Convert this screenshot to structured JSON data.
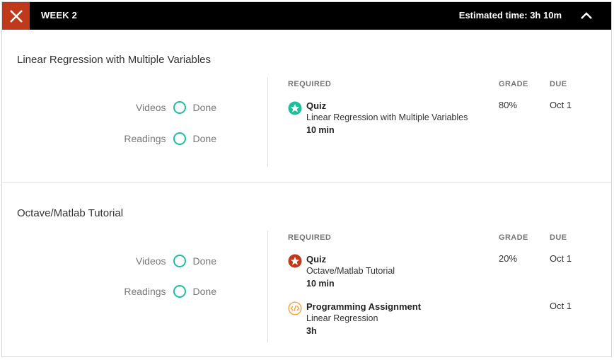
{
  "header": {
    "week_label": "WEEK 2",
    "estimated_time": "Estimated time: 3h 10m"
  },
  "colors": {
    "accent": "#c0391b",
    "done_ring": "#1fbf9e",
    "quiz_pass": "#1fbf9e",
    "quiz_fail": "#c0391b",
    "programming": "#f5a23a"
  },
  "lessons": [
    {
      "title": "Linear Regression with Multiple Variables",
      "progress": [
        {
          "label": "Videos",
          "status": "Done"
        },
        {
          "label": "Readings",
          "status": "Done"
        }
      ],
      "columns": {
        "required": "REQUIRED",
        "grade": "GRADE",
        "due": "DUE"
      },
      "items": [
        {
          "icon": "star-badge-icon",
          "type": "Quiz",
          "name": "Linear Regression with Multiple Variables",
          "duration": "10 min",
          "grade": "80%",
          "due": "Oct 1"
        }
      ]
    },
    {
      "title": "Octave/Matlab Tutorial",
      "progress": [
        {
          "label": "Videos",
          "status": "Done"
        },
        {
          "label": "Readings",
          "status": "Done"
        }
      ],
      "columns": {
        "required": "REQUIRED",
        "grade": "GRADE",
        "due": "DUE"
      },
      "items": [
        {
          "icon": "star-badge-icon",
          "type": "Quiz",
          "name": "Octave/Matlab Tutorial",
          "duration": "10 min",
          "grade": "20%",
          "due": "Oct 1"
        },
        {
          "icon": "code-icon",
          "type": "Programming Assignment",
          "name": "Linear Regression",
          "duration": "3h",
          "grade": "",
          "due": "Oct 1"
        }
      ]
    }
  ]
}
